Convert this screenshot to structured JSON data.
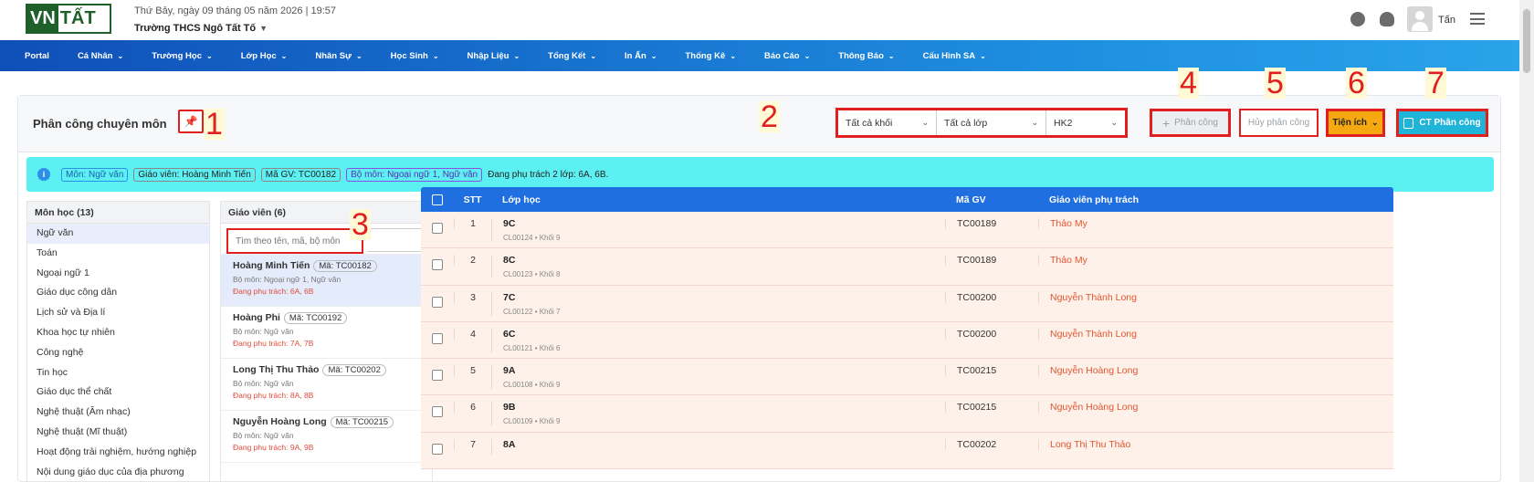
{
  "header": {
    "logo_text_a": "VN",
    "logo_text_b": "TẤT",
    "date_text": "Thứ Bảy, ngày 09 tháng 05 năm 2026 | 19:57",
    "school_name": "Trường THCS Ngô Tất Tố",
    "user_name": "Tấn"
  },
  "nav": {
    "items": [
      {
        "label": "Portal",
        "has_menu": false
      },
      {
        "label": "Cá Nhân",
        "has_menu": true
      },
      {
        "label": "Trường Học",
        "has_menu": true
      },
      {
        "label": "Lớp Học",
        "has_menu": true
      },
      {
        "label": "Nhân Sự",
        "has_menu": true
      },
      {
        "label": "Học Sinh",
        "has_menu": true
      },
      {
        "label": "Nhập Liệu",
        "has_menu": true
      },
      {
        "label": "Tổng Kết",
        "has_menu": true
      },
      {
        "label": "In Ấn",
        "has_menu": true
      },
      {
        "label": "Thống Kê",
        "has_menu": true
      },
      {
        "label": "Báo Cáo",
        "has_menu": true
      },
      {
        "label": "Thông Báo",
        "has_menu": true
      },
      {
        "label": "Cấu Hình SA",
        "has_menu": true
      }
    ]
  },
  "page": {
    "title": "Phân công chuyên môn",
    "annotations": [
      "1",
      "2",
      "3",
      "4",
      "5",
      "6",
      "7"
    ]
  },
  "filters": {
    "grade": "Tất cả khối",
    "class": "Tất cả lớp",
    "term": "HK2"
  },
  "actions": {
    "assign": "Phân công",
    "cancel_assign": "Hủy phân công",
    "utilities": "Tiện ích",
    "detail": "CT Phân công"
  },
  "info": {
    "subject": "Môn: Ngữ văn",
    "teacher": "Giáo viên: Hoàng Minh Tiến",
    "code": "Mã GV: TC00182",
    "subjects": "Bộ môn: Ngoại ngữ 1, Ngữ văn",
    "load": "Đang phụ trách 2 lớp: 6A, 6B."
  },
  "subjects": {
    "header": "Môn học (13)",
    "items": [
      "Ngữ văn",
      "Toán",
      "Ngoại ngữ 1",
      "Giáo dục công dân",
      "Lịch sử và Địa lí",
      "Khoa học tự nhiên",
      "Công nghệ",
      "Tin học",
      "Giáo dục thể chất",
      "Nghệ thuật (Âm nhạc)",
      "Nghệ thuật (Mĩ thuật)",
      "Hoạt động trải nghiệm, hướng nghiệp",
      "Nội dung giáo dục của địa phương"
    ]
  },
  "teachers": {
    "header": "Giáo viên (6)",
    "search_placeholder": "Tìm theo tên, mã, bộ môn",
    "items": [
      {
        "name": "Hoàng Minh Tiến",
        "code": "Mã: TC00182",
        "subject": "Bộ môn: Ngoại ngữ 1, Ngữ văn",
        "load": "Đang phụ trách: 6A, 6B"
      },
      {
        "name": "Hoàng Phi",
        "code": "Mã: TC00192",
        "subject": "Bộ môn: Ngữ văn",
        "load": "Đang phụ trách: 7A, 7B"
      },
      {
        "name": "Long Thị Thu Thảo",
        "code": "Mã: TC00202",
        "subject": "Bộ môn: Ngữ văn",
        "load": "Đang phụ trách: 8A, 8B"
      },
      {
        "name": "Nguyễn Hoàng Long",
        "code": "Mã: TC00215",
        "subject": "Bộ môn: Ngữ văn",
        "load": "Đang phụ trách: 9A, 9B"
      }
    ]
  },
  "table": {
    "columns": {
      "stt": "STT",
      "class": "Lớp học",
      "code": "Mã GV",
      "teacher": "Giáo viên phụ trách"
    },
    "rows": [
      {
        "stt": "1",
        "class": "9C",
        "class_sub": "CL00124 • Khối 9",
        "code": "TC00189",
        "teacher": "Thảo My"
      },
      {
        "stt": "2",
        "class": "8C",
        "class_sub": "CL00123 • Khối 8",
        "code": "TC00189",
        "teacher": "Thảo My"
      },
      {
        "stt": "3",
        "class": "7C",
        "class_sub": "CL00122 • Khối 7",
        "code": "TC00200",
        "teacher": "Nguyễn Thành Long"
      },
      {
        "stt": "4",
        "class": "6C",
        "class_sub": "CL00121 • Khối 6",
        "code": "TC00200",
        "teacher": "Nguyễn Thành Long"
      },
      {
        "stt": "5",
        "class": "9A",
        "class_sub": "CL00108 • Khối 9",
        "code": "TC00215",
        "teacher": "Nguyễn Hoàng Long"
      },
      {
        "stt": "6",
        "class": "9B",
        "class_sub": "CL00109 • Khối 9",
        "code": "TC00215",
        "teacher": "Nguyễn Hoàng Long"
      },
      {
        "stt": "7",
        "class": "8A",
        "class_sub": "",
        "code": "TC00202",
        "teacher": "Long Thị Thu Thảo"
      }
    ]
  }
}
